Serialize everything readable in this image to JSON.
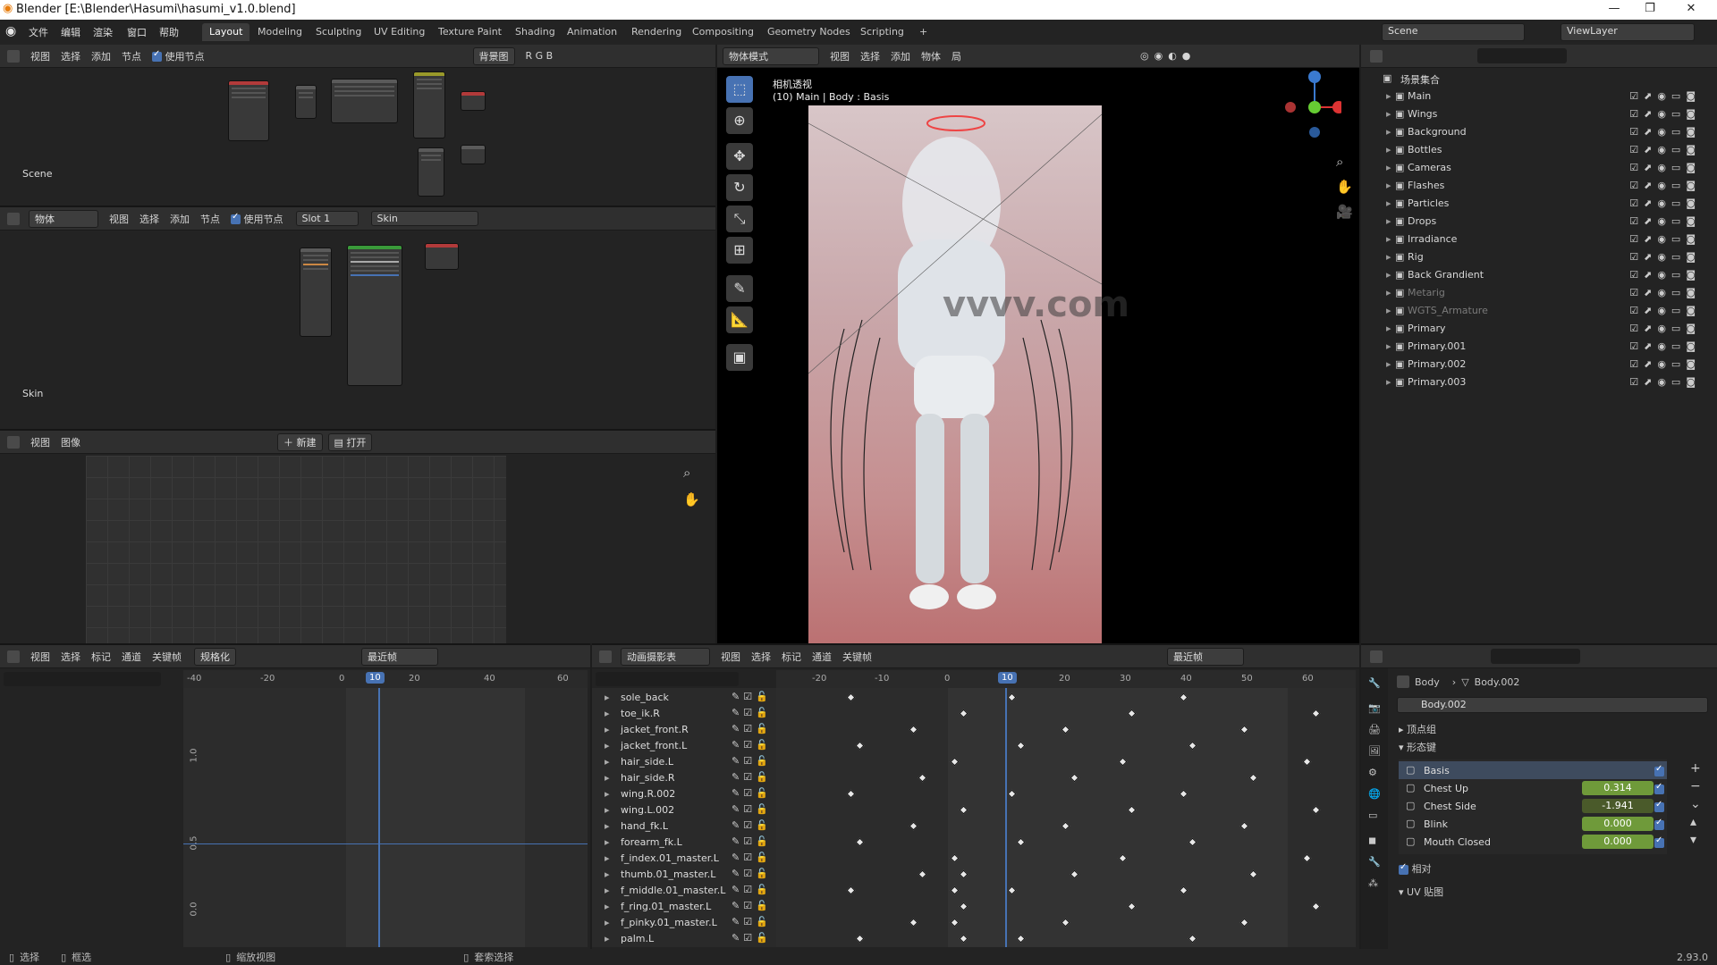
{
  "window": {
    "title": "Blender [E:\\Blender\\Hasumi\\hasumi_v1.0.blend]"
  },
  "menu": [
    "文件",
    "编辑",
    "渲染",
    "窗口",
    "帮助"
  ],
  "workspaces": [
    "Layout",
    "Modeling",
    "Sculpting",
    "UV Editing",
    "Texture Paint",
    "Shading",
    "Animation",
    "Rendering",
    "Compositing",
    "Geometry Nodes",
    "Scripting"
  ],
  "scene": {
    "name": "Scene",
    "view_layer": "ViewLayer"
  },
  "node_editor_top": {
    "menus": [
      "视图",
      "选择",
      "添加",
      "节点"
    ],
    "use_nodes": "使用节点",
    "bg_label": "背景图",
    "channels": "R G B",
    "label": "Scene"
  },
  "node_editor_mid": {
    "type": "物体",
    "menus": [
      "视图",
      "选择",
      "添加",
      "节点"
    ],
    "use_nodes": "使用节点",
    "slot": "Slot 1",
    "material": "Skin",
    "label": "Skin"
  },
  "image_editor": {
    "menus": [
      "视图",
      "图像"
    ],
    "new": "新建",
    "open": "打开"
  },
  "viewport": {
    "mode": "物体模式",
    "menus": [
      "视图",
      "选择",
      "添加",
      "物体"
    ],
    "transform": "局",
    "title": "相机透视",
    "subtitle": "(10) Main | Body : Basis",
    "watermark": "vvvv.com"
  },
  "outliner": {
    "root": "场景集合",
    "items": [
      {
        "name": "Main",
        "dim": false
      },
      {
        "name": "Wings",
        "dim": false
      },
      {
        "name": "Background",
        "dim": false
      },
      {
        "name": "Bottles",
        "dim": false
      },
      {
        "name": "Cameras",
        "dim": false
      },
      {
        "name": "Flashes",
        "dim": false
      },
      {
        "name": "Particles",
        "dim": false
      },
      {
        "name": "Drops",
        "dim": false
      },
      {
        "name": "Irradiance",
        "dim": false
      },
      {
        "name": "Rig",
        "dim": false
      },
      {
        "name": "Back Grandient",
        "dim": false
      },
      {
        "name": "Metarig",
        "dim": true
      },
      {
        "name": "WGTS_Armature",
        "dim": true
      },
      {
        "name": "Primary",
        "dim": false
      },
      {
        "name": "Primary.001",
        "dim": false
      },
      {
        "name": "Primary.002",
        "dim": false
      },
      {
        "name": "Primary.003",
        "dim": false
      }
    ]
  },
  "graph_editor": {
    "menus": [
      "视图",
      "选择",
      "标记",
      "通道",
      "关键帧"
    ],
    "normalize": "规格化",
    "interp": "最近帧",
    "ticks": [
      "-40",
      "-20",
      "0",
      "20",
      "40",
      "60"
    ],
    "y_ticks": [
      "1.0",
      "0.5",
      "0.0"
    ],
    "current_frame": "10"
  },
  "dopesheet": {
    "mode": "动画摄影表",
    "menus": [
      "视图",
      "选择",
      "标记",
      "通道",
      "关键帧"
    ],
    "interp": "最近帧",
    "ticks": [
      "-20",
      "-10",
      "0",
      "20",
      "30",
      "40",
      "50",
      "60"
    ],
    "current_frame": "10",
    "channels": [
      "sole_back",
      "toe_ik.R",
      "jacket_front.R",
      "jacket_front.L",
      "hair_side.L",
      "hair_side.R",
      "wing.R.002",
      "wing.L.002",
      "hand_fk.L",
      "forearm_fk.L",
      "f_index.01_master.L",
      "thumb.01_master.L",
      "f_middle.01_master.L",
      "f_ring.01_master.L",
      "f_pinky.01_master.L",
      "palm.L"
    ]
  },
  "properties": {
    "object": "Body",
    "mesh": "Body.002",
    "mesh_field": "Body.002",
    "vertex_groups": "顶点组",
    "shape_keys": "形态键",
    "keys": [
      {
        "name": "Basis",
        "value": ""
      },
      {
        "name": "Chest Up",
        "value": "0.314"
      },
      {
        "name": "Chest Side",
        "value": "-1.941"
      },
      {
        "name": "Blink",
        "value": "0.000"
      },
      {
        "name": "Mouth Closed",
        "value": "0.000"
      }
    ],
    "relative": "相对",
    "uv": "UV 贴图"
  },
  "statusbar": {
    "select": "选择",
    "box": "框选",
    "zoom": "缩放视图",
    "lasso": "套索选择",
    "version": "2.93.0"
  }
}
